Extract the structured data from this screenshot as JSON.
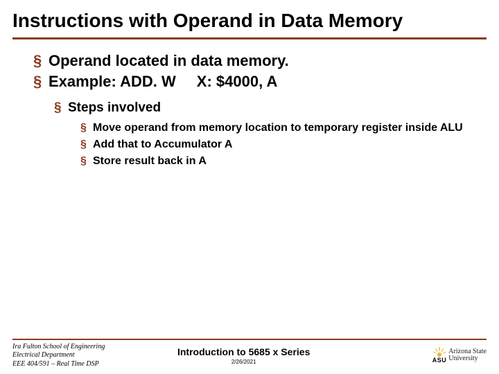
{
  "title": "Instructions with Operand in Data Memory",
  "bullets": {
    "l1a": "Operand located in data memory.",
    "l1b_prefix": "Example: ADD. W",
    "l1b_suffix": "X: $4000, A",
    "l2a": "Steps involved",
    "l3a": "Move operand from memory location to temporary register inside ALU",
    "l3b": "Add that to Accumulator A",
    "l3c": "Store result back in A"
  },
  "footer": {
    "left1": "Ira Fulton School of Engineering",
    "left2": "Electrical Department",
    "left3": "EEE 404/591 – Real Time DSP",
    "center_title": "Introduction to 5685 x Series",
    "date": "2/26/2021",
    "asu_abbrev": "ASU",
    "asu_name1": "Arizona State",
    "asu_name2": "University"
  },
  "colors": {
    "accent": "#8b3a1e",
    "asu_gold": "#f2b430"
  }
}
